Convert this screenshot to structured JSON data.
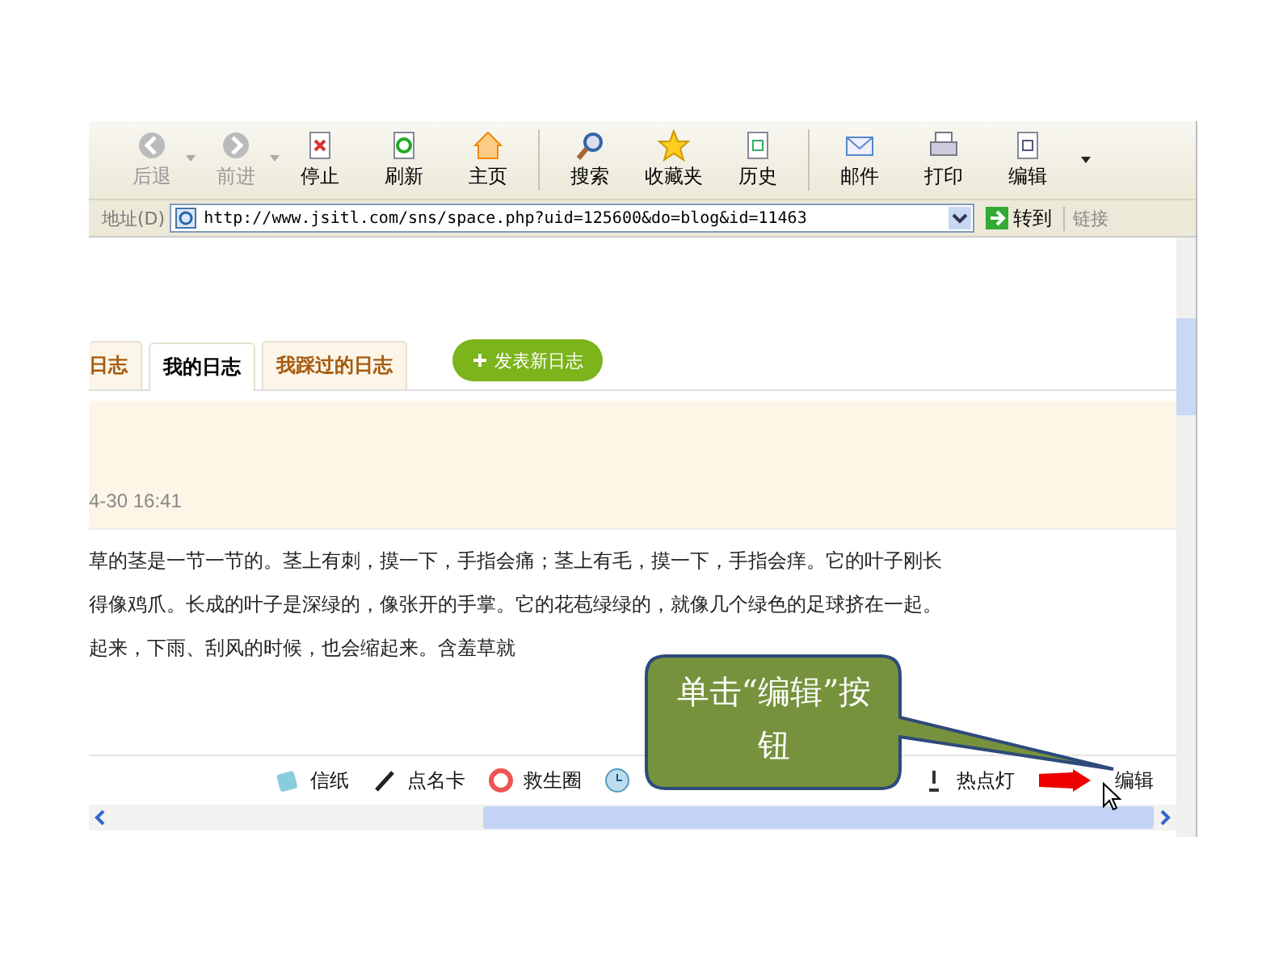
{
  "toolbar": {
    "buttons": [
      {
        "label": "后退",
        "kind": "back",
        "disabled": true,
        "dropdown": true
      },
      {
        "label": "前进",
        "kind": "forward",
        "disabled": true,
        "dropdown": true
      },
      {
        "label": "停止",
        "kind": "stop",
        "disabled": false,
        "dropdown": false
      },
      {
        "label": "刷新",
        "kind": "refresh",
        "disabled": false,
        "dropdown": false
      },
      {
        "label": "主页",
        "kind": "home",
        "disabled": false,
        "dropdown": false
      },
      {
        "label": "搜索",
        "kind": "search",
        "disabled": false,
        "dropdown": false
      },
      {
        "label": "收藏夹",
        "kind": "favorites",
        "disabled": false,
        "dropdown": false
      },
      {
        "label": "历史",
        "kind": "history",
        "disabled": false,
        "dropdown": false
      },
      {
        "label": "邮件",
        "kind": "mail",
        "disabled": false,
        "dropdown": false
      },
      {
        "label": "打印",
        "kind": "print",
        "disabled": false,
        "dropdown": false
      },
      {
        "label": "编辑",
        "kind": "edit",
        "disabled": false,
        "dropdown": false
      }
    ]
  },
  "address_bar": {
    "label": "地址(D)",
    "url": "http://www.jsitl.com/sns/space.php?uid=125600&do=blog&id=11463",
    "go": "转到",
    "links": "链接"
  },
  "tabs": [
    {
      "label": "日志",
      "selected": false
    },
    {
      "label": "我的日志",
      "selected": true
    },
    {
      "label": "我踩过的日志",
      "selected": false
    }
  ],
  "new_post_button": "发表新日志",
  "post": {
    "date": "4-30 16:41",
    "lines": [
      "草的茎是一节一节的。茎上有刺，摸一下，手指会痛；茎上有毛，摸一下，手指会痒。它的叶子刚长",
      "得像鸡爪。长成的叶子是深绿的，像张开的手掌。它的花苞绿绿的，就像几个绿色的足球挤在一起。",
      "起来，下雨、刮风的时候，也会缩起来。含羞草就"
    ]
  },
  "post_tools": [
    {
      "label": "信纸",
      "kind": "paper"
    },
    {
      "label": "点名卡",
      "kind": "pen"
    },
    {
      "label": "救生圈",
      "kind": "lifebuoy"
    },
    {
      "kind": "clock"
    },
    {
      "label": "热点灯",
      "kind": "lamp"
    },
    {
      "kind": "red-arrow"
    },
    {
      "label": "编辑",
      "kind": "none"
    }
  ],
  "callout": "单击“编辑”按钮"
}
